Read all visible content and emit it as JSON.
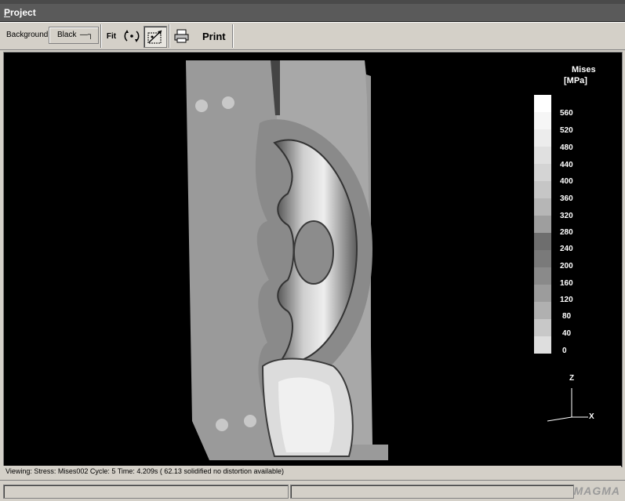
{
  "menu": {
    "project_label": "Project"
  },
  "toolbar": {
    "background_label": "Background:",
    "background_value": "Black",
    "fit_label": "Fit",
    "print_label": "Print"
  },
  "legend": {
    "title": "Mises",
    "unit": "[MPa]",
    "labels": [
      "560",
      "520",
      "480",
      "440",
      "400",
      "360",
      "320",
      "280",
      "240",
      "200",
      "160",
      "120",
      "80",
      "40",
      "0"
    ]
  },
  "axes": {
    "z": "Z",
    "x": "X"
  },
  "status": {
    "viewing": "Viewing: Stress: Mises002 Cycle: 5  Time: 4.209s ( 62.13 solidified  no distortion available)"
  },
  "brand": {
    "logo": "MAGMA"
  }
}
